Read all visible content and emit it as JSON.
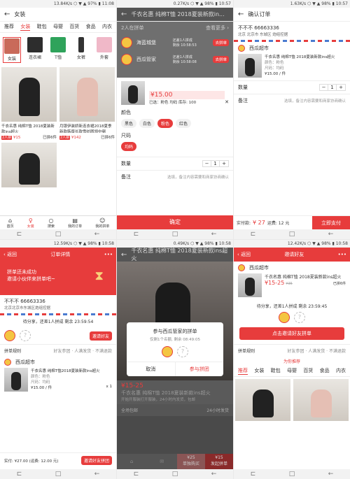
{
  "status": {
    "p1": "13.84K/s ⬡ ▼ ▲ 97% ▮ 11:08",
    "p2": "0.27K/s ⬡ ▼ ▲ 98% ▮ 10:57",
    "p3": "1.63K/s ⬡ ▼ ▲ 98% ▮ 10:57",
    "p4": "12.59K/s ⬡ ▼ ▲ 98% ▮ 10:58",
    "p5": "0.49K/s ⬡ ▼ ▲ 98% ▮ 10:58",
    "p6": "12.42K/s ⬡ ▼ ▲ 98% ▮ 10:58"
  },
  "sysnav": {
    "recent": "⊏",
    "home": "□",
    "back": "←"
  },
  "p1": {
    "title": "女装",
    "tabs": [
      "推荐",
      "女装",
      "鞋包",
      "母婴",
      "百货",
      "食品",
      "内衣"
    ],
    "cats": [
      "女装",
      "连衣裙",
      "T恤",
      "女裤",
      "外套"
    ],
    "products": [
      {
        "name": "千衣名惠 纯棉T恤 2018夏装新款ins超火",
        "price": "¥15",
        "sold": "已拼6件",
        "tag": "2人拼"
      },
      {
        "name": "月银伊装娇新连衣裙2018夏季新款韩版长款雪纺圆领中喇",
        "price": "¥142",
        "sold": "已拼6件",
        "tag": "2人拼"
      }
    ],
    "bottom": [
      "首页",
      "女装",
      "搜索",
      "我的订单",
      "我的拼单"
    ]
  },
  "p2": {
    "title": "千衣名惠 纯棉T恤 2018夏装新款in...",
    "group_count": "2人在拼单",
    "more": "查看更多 ›",
    "g1_name": "海蓝城堡",
    "g1_info": "还差1人拼成",
    "g1_time": "剩余 10:58:53",
    "g1_btn": "去拼单",
    "g2_name": "西瓜管家",
    "g2_info": "还差1人拼成",
    "g2_time": "剩余 10:58:08",
    "g2_btn": "去拼单",
    "price": "¥15.00",
    "selected": "已选：粉色 均码 库存: 100",
    "color_label": "颜色",
    "colors": [
      "黑色",
      "白色",
      "粉色",
      "红色"
    ],
    "size_label": "尺码",
    "size": "均码",
    "qty_label": "数量",
    "qty": "1",
    "note_label": "备注",
    "note_ph": "选填，备注内容需要和商家协商确认",
    "confirm": "确定"
  },
  "p3": {
    "title": "确认订单",
    "addr_name": "不不不 66663336",
    "addr": "北京 北京市 东城区 炮组控据",
    "shop": "西瓜超市",
    "goods": "千衣名惠 纯棉T恤 2018夏装新款ins超火",
    "spec": "颜色：粉色",
    "size": "尺码：均码",
    "unit_price": "¥15.00 / 件",
    "qty_label": "数量",
    "qty": "1",
    "note_label": "备注",
    "note_ph": "选填，备注内容需要和商家协商确认",
    "pay_label": "实付款:",
    "pay": "¥ 27",
    "ship": "运费: 12 元",
    "pay_btn": "立即支付"
  },
  "p4": {
    "back": "‹ 返回",
    "title": "订单详情",
    "banner1": "拼单还未成功",
    "banner2": "邀请小伙伴来拼单吧~",
    "addr_name": "不不不 66663336",
    "addr": "北京北京市东城区炮组控据",
    "wait": "待分享，还差1人拼成 剩余 23:59:54",
    "invite": "邀请好友",
    "rules": "拼单规则",
    "rules_text": "好友参团 · 人满发货 · 不满退款",
    "shop": "西瓜超市",
    "goods": "千衣名惠 纯棉T恤2018夏装新款ins超火",
    "spec": "颜色：粉色",
    "size": "尺码：均码",
    "unit_price": "¥15.00 / 件",
    "qty": "x 1",
    "paid": "实付: ¥27.00 (运费: 12.00 元)",
    "invite2": "邀请好友拼团"
  },
  "p5": {
    "title": "千衣名惠 纯棉T恤 2018夏装新款ins超火",
    "modal_title": "参与西瓜管家的拼单",
    "modal_info": "仅剩1个名额, 剩余 08:49:05",
    "cancel": "取消",
    "join": "参与拼团",
    "price": "¥15-25",
    "name": "千衣名惠 纯棉T恤 2018夏装新款ins超火",
    "desc": "开始开服装打开服装，24小时内发货，包邮",
    "g1": "全场包邮",
    "g2": "24小时发货",
    "cart1": "¥25",
    "cart1_sub": "单独购买",
    "cart2": "¥15",
    "cart2_sub": "发起拼单"
  },
  "p6": {
    "back": "‹ 返回",
    "title": "邀请好友",
    "shop": "西瓜超市",
    "goods": "千衣名惠 纯棉T恤 2018夏装新款ins超火",
    "price": "¥15-25",
    "old_price": "¥35",
    "sold": "已拼6件",
    "wait": "待分享，还差1人拼成 剩余 23:59:45",
    "invite": "点击邀请好友拼单",
    "rules": "拼单规则",
    "rules_text": "好友参团 · 人满发货 · 不满退款",
    "rec": "为你推荐",
    "tabs": [
      "推荐",
      "女装",
      "鞋包",
      "母婴",
      "百货",
      "食品",
      "内衣"
    ]
  }
}
